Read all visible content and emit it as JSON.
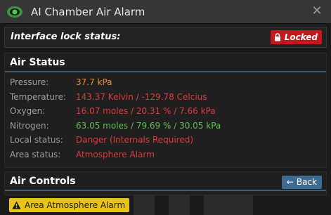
{
  "window": {
    "title": "AI Chamber Air Alarm"
  },
  "lock": {
    "label": "Interface lock status:",
    "button_label": "Locked"
  },
  "air_status": {
    "header": "Air Status",
    "rows": [
      {
        "key": "Pressure:",
        "value": "37.7 kPa",
        "color": "#e2913a"
      },
      {
        "key": "Temperature:",
        "value": "143.37 Kelvin / -129.78 Celcius",
        "color": "#dc3b3b"
      },
      {
        "key": "Oxygen:",
        "value": "16.07 moles / 20.31 % / 7.66 kPa",
        "color": "#dc3b3b"
      },
      {
        "key": "Nitrogen:",
        "value": "63.05 moles / 79.69 % / 30.05 kPa",
        "color": "#5fbe4a"
      },
      {
        "key": "Local status:",
        "value": "Danger (Internals Required)",
        "color": "#dc3b3b"
      },
      {
        "key": "Area status:",
        "value": "Atmosphere Alarm",
        "color": "#dc3b3b"
      }
    ]
  },
  "air_controls": {
    "header": "Air Controls",
    "back_label": "Back",
    "alarm_label": "Area Atmosphere Alarm"
  },
  "icons": {
    "title": "eye-icon",
    "close": "close-icon",
    "lock": "lock-icon",
    "back": "arrow-left-icon",
    "warning": "warning-icon"
  }
}
